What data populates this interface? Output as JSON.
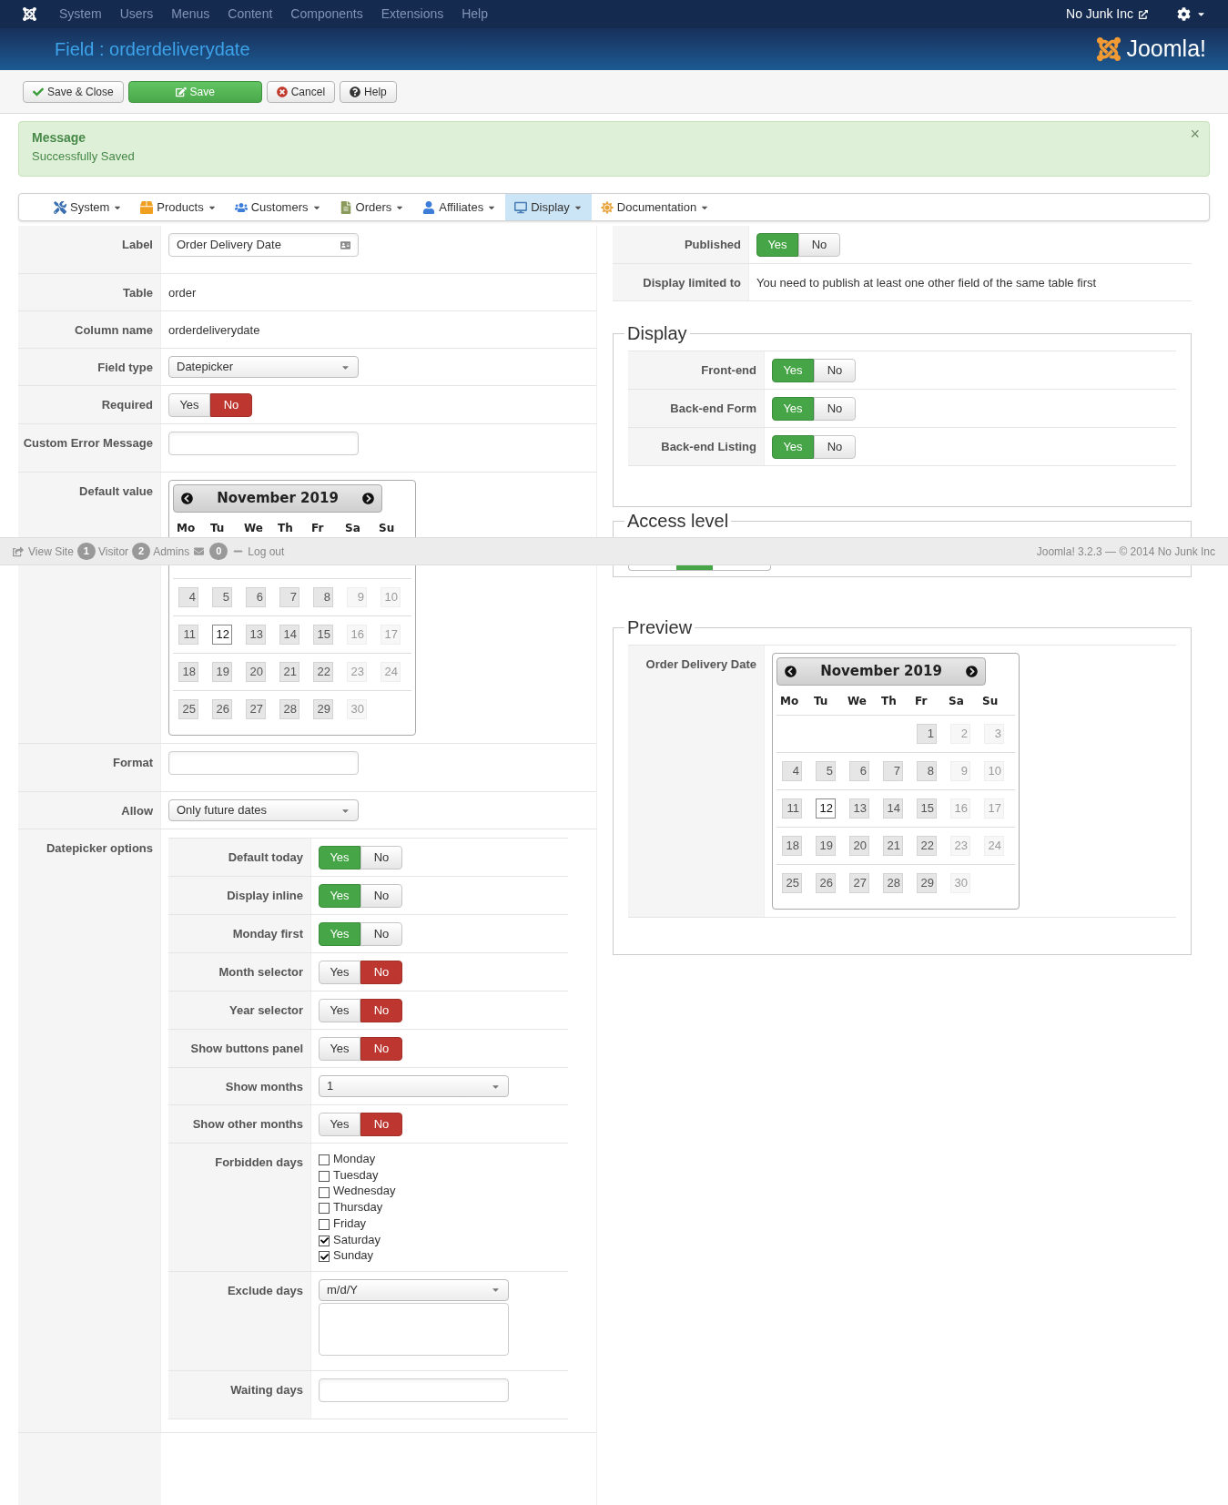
{
  "topbar": {
    "menu": [
      "System",
      "Users",
      "Menus",
      "Content",
      "Components",
      "Extensions",
      "Help"
    ],
    "site": "No Junk Inc"
  },
  "header": {
    "title": "Field : orderdeliverydate",
    "logo": "Joomla!"
  },
  "toolbar": [
    {
      "label": "Save & Close",
      "kind": "default"
    },
    {
      "label": "Save",
      "kind": "primary"
    },
    {
      "label": "Cancel",
      "kind": "default"
    },
    {
      "label": "Help",
      "kind": "default"
    }
  ],
  "message": {
    "title": "Message",
    "text": "Successfully Saved",
    "close": "×"
  },
  "submenu": [
    {
      "label": "System",
      "selected": false
    },
    {
      "label": "Products",
      "selected": false
    },
    {
      "label": "Customers",
      "selected": false
    },
    {
      "label": "Orders",
      "selected": false
    },
    {
      "label": "Affiliates",
      "selected": false
    },
    {
      "label": "Display",
      "selected": true
    },
    {
      "label": "Documentation",
      "selected": false
    }
  ],
  "left_rows": [
    {
      "kind": "input",
      "label": "Label",
      "value": "Order Delivery Date",
      "addon": true
    },
    {
      "kind": "text",
      "label": "Table",
      "value": "order"
    },
    {
      "kind": "text",
      "label": "Column name",
      "value": "orderdeliverydate"
    },
    {
      "kind": "select",
      "label": "Field type",
      "value": "Datepicker"
    },
    {
      "kind": "toggle",
      "label": "Required",
      "options": [
        {
          "label": "Yes",
          "selected": false
        },
        {
          "label": "No",
          "selected": true
        }
      ]
    },
    {
      "kind": "input",
      "label": "Custom Error Message"
    },
    {
      "kind": "calendar",
      "label": "Default value",
      "calendar": {
        "title": "November 2019",
        "first_week_covered": true,
        "weekdays": [
          "Mo",
          "Tu",
          "We",
          "Th",
          "Fr",
          "Sa",
          "Su"
        ],
        "weeks": [
          [
            {
              "d": "4",
              "disabled": false,
              "selected": false
            },
            {
              "d": "5",
              "disabled": false,
              "selected": false
            },
            {
              "d": "6",
              "disabled": false,
              "selected": false
            },
            {
              "d": "7",
              "disabled": false,
              "selected": false
            },
            {
              "d": "8",
              "disabled": false,
              "selected": false
            },
            {
              "d": "9",
              "disabled": true,
              "selected": false
            },
            {
              "d": "10",
              "disabled": true,
              "selected": false
            }
          ],
          [
            {
              "d": "11",
              "disabled": false,
              "selected": false
            },
            {
              "d": "12",
              "disabled": false,
              "selected": true
            },
            {
              "d": "13",
              "disabled": false,
              "selected": false
            },
            {
              "d": "14",
              "disabled": false,
              "selected": false
            },
            {
              "d": "15",
              "disabled": false,
              "selected": false
            },
            {
              "d": "16",
              "disabled": true,
              "selected": false
            },
            {
              "d": "17",
              "disabled": true,
              "selected": false
            }
          ],
          [
            {
              "d": "18",
              "disabled": false,
              "selected": false
            },
            {
              "d": "19",
              "disabled": false,
              "selected": false
            },
            {
              "d": "20",
              "disabled": false,
              "selected": false
            },
            {
              "d": "21",
              "disabled": false,
              "selected": false
            },
            {
              "d": "22",
              "disabled": false,
              "selected": false
            },
            {
              "d": "23",
              "disabled": true,
              "selected": false
            },
            {
              "d": "24",
              "disabled": true,
              "selected": false
            }
          ],
          [
            {
              "d": "25",
              "disabled": false,
              "selected": false
            },
            {
              "d": "26",
              "disabled": false,
              "selected": false
            },
            {
              "d": "27",
              "disabled": false,
              "selected": false
            },
            {
              "d": "28",
              "disabled": false,
              "selected": false
            },
            {
              "d": "29",
              "disabled": false,
              "selected": false
            },
            {
              "d": "30",
              "disabled": true,
              "selected": false
            }
          ]
        ]
      }
    },
    {
      "kind": "input",
      "label": "Format"
    },
    {
      "kind": "select",
      "label": "Allow",
      "value": "Only future dates"
    },
    {
      "kind": "options",
      "label": "Datepicker options",
      "rows": [
        {
          "kind": "toggle",
          "label": "Default today",
          "options": [
            {
              "label": "Yes",
              "selected": true
            },
            {
              "label": "No",
              "selected": false
            }
          ]
        },
        {
          "kind": "toggle",
          "label": "Display inline",
          "options": [
            {
              "label": "Yes",
              "selected": true
            },
            {
              "label": "No",
              "selected": false
            }
          ]
        },
        {
          "kind": "toggle",
          "label": "Monday first",
          "options": [
            {
              "label": "Yes",
              "selected": true
            },
            {
              "label": "No",
              "selected": false
            }
          ]
        },
        {
          "kind": "toggle",
          "label": "Month selector",
          "options": [
            {
              "label": "Yes",
              "selected": false
            },
            {
              "label": "No",
              "selected": true
            }
          ]
        },
        {
          "kind": "toggle",
          "label": "Year selector",
          "options": [
            {
              "label": "Yes",
              "selected": false
            },
            {
              "label": "No",
              "selected": true
            }
          ]
        },
        {
          "kind": "toggle",
          "label": "Show buttons panel",
          "options": [
            {
              "label": "Yes",
              "selected": false
            },
            {
              "label": "No",
              "selected": true
            }
          ]
        },
        {
          "kind": "select",
          "label": "Show months",
          "value": "1"
        },
        {
          "kind": "toggle",
          "label": "Show other months",
          "options": [
            {
              "label": "Yes",
              "selected": false
            },
            {
              "label": "No",
              "selected": true
            }
          ]
        },
        {
          "kind": "checks",
          "label": "Forbidden days",
          "items": [
            {
              "label": "Monday",
              "checked": false
            },
            {
              "label": "Tuesday",
              "checked": false
            },
            {
              "label": "Wednesday",
              "checked": false
            },
            {
              "label": "Thursday",
              "checked": false
            },
            {
              "label": "Friday",
              "checked": false
            },
            {
              "label": "Saturday",
              "checked": true
            },
            {
              "label": "Sunday",
              "checked": true
            }
          ]
        },
        {
          "kind": "select-textarea",
          "label": "Exclude days",
          "value": "m/d/Y"
        },
        {
          "kind": "input",
          "label": "Waiting days"
        }
      ]
    }
  ],
  "right": {
    "rows": [
      {
        "kind": "toggle",
        "label": "Published",
        "options": [
          {
            "label": "Yes",
            "selected": true
          },
          {
            "label": "No",
            "selected": false
          }
        ]
      },
      {
        "kind": "text",
        "label": "Display limited to",
        "value": "You need to publish at least one other field of the same table first"
      }
    ],
    "fieldsets": [
      {
        "legend": "Display",
        "rows": [
          {
            "kind": "toggle",
            "label": "Front-end",
            "options": [
              {
                "label": "Yes",
                "selected": true
              },
              {
                "label": "No",
                "selected": false
              }
            ]
          },
          {
            "kind": "toggle",
            "label": "Back-end Form",
            "options": [
              {
                "label": "Yes",
                "selected": true
              },
              {
                "label": "No",
                "selected": false
              }
            ]
          },
          {
            "kind": "toggle",
            "label": "Back-end Listing",
            "options": [
              {
                "label": "Yes",
                "selected": true
              },
              {
                "label": "No",
                "selected": false
              }
            ]
          }
        ]
      },
      {
        "legend": "Access level"
      },
      {
        "legend": "Preview",
        "rows": [
          {
            "kind": "calendar",
            "label": "Order Delivery Date",
            "calendar": {
              "title": "November 2019",
              "first_week_covered": false,
              "weekdays": [
                "Mo",
                "Tu",
                "We",
                "Th",
                "Fr",
                "Sa",
                "Su"
              ],
              "weeks": [
                [
                  {
                    "d": "1",
                    "disabled": false,
                    "selected": false
                  },
                  {
                    "d": "2",
                    "disabled": true,
                    "selected": false
                  },
                  {
                    "d": "3",
                    "disabled": true,
                    "selected": false
                  }
                ],
                [
                  {
                    "d": "4",
                    "disabled": false,
                    "selected": false
                  },
                  {
                    "d": "5",
                    "disabled": false,
                    "selected": false
                  },
                  {
                    "d": "6",
                    "disabled": false,
                    "selected": false
                  },
                  {
                    "d": "7",
                    "disabled": false,
                    "selected": false
                  },
                  {
                    "d": "8",
                    "disabled": false,
                    "selected": false
                  },
                  {
                    "d": "9",
                    "disabled": true,
                    "selected": false
                  },
                  {
                    "d": "10",
                    "disabled": true,
                    "selected": false
                  }
                ],
                [
                  {
                    "d": "11",
                    "disabled": false,
                    "selected": false
                  },
                  {
                    "d": "12",
                    "disabled": false,
                    "selected": true
                  },
                  {
                    "d": "13",
                    "disabled": false,
                    "selected": false
                  },
                  {
                    "d": "14",
                    "disabled": false,
                    "selected": false
                  },
                  {
                    "d": "15",
                    "disabled": false,
                    "selected": false
                  },
                  {
                    "d": "16",
                    "disabled": true,
                    "selected": false
                  },
                  {
                    "d": "17",
                    "disabled": true,
                    "selected": false
                  }
                ],
                [
                  {
                    "d": "18",
                    "disabled": false,
                    "selected": false
                  },
                  {
                    "d": "19",
                    "disabled": false,
                    "selected": false
                  },
                  {
                    "d": "20",
                    "disabled": false,
                    "selected": false
                  },
                  {
                    "d": "21",
                    "disabled": false,
                    "selected": false
                  },
                  {
                    "d": "22",
                    "disabled": false,
                    "selected": false
                  },
                  {
                    "d": "23",
                    "disabled": true,
                    "selected": false
                  },
                  {
                    "d": "24",
                    "disabled": true,
                    "selected": false
                  }
                ],
                [
                  {
                    "d": "25",
                    "disabled": false,
                    "selected": false
                  },
                  {
                    "d": "26",
                    "disabled": false,
                    "selected": false
                  },
                  {
                    "d": "27",
                    "disabled": false,
                    "selected": false
                  },
                  {
                    "d": "28",
                    "disabled": false,
                    "selected": false
                  },
                  {
                    "d": "29",
                    "disabled": false,
                    "selected": false
                  },
                  {
                    "d": "30",
                    "disabled": true,
                    "selected": false
                  }
                ]
              ]
            }
          }
        ]
      }
    ]
  },
  "status_bar": {
    "left": [
      {
        "kind": "link",
        "label": "View Site"
      },
      {
        "kind": "badge",
        "label": "1"
      },
      {
        "kind": "text",
        "label": "Visitor"
      },
      {
        "kind": "badge",
        "label": "2"
      },
      {
        "kind": "text",
        "label": "Admins"
      },
      {
        "kind": "mail-badge",
        "label": "0"
      },
      {
        "kind": "logout",
        "label": "Log out"
      }
    ],
    "right": "Joomla! 3.2.3 — © 2014 No Junk Inc"
  }
}
